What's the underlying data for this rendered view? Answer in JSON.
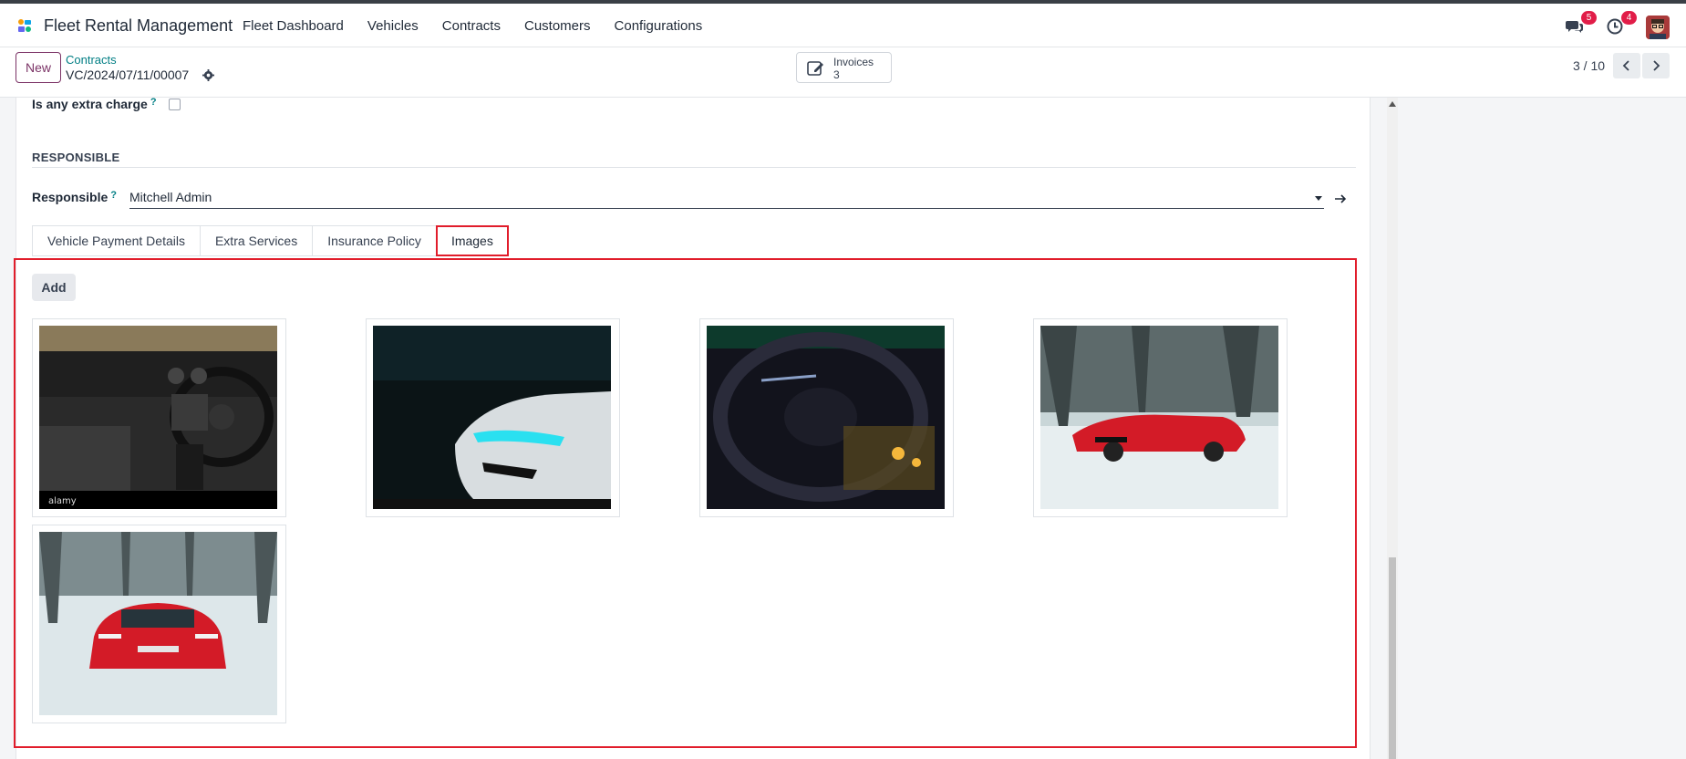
{
  "nav": {
    "app_name": "Fleet Rental Management",
    "menu": [
      "Fleet Dashboard",
      "Vehicles",
      "Contracts",
      "Customers",
      "Configurations"
    ],
    "messages_count": "5",
    "activities_count": "4"
  },
  "control_panel": {
    "new_label": "New",
    "breadcrumb_parent": "Contracts",
    "breadcrumb_current": "VC/2024/07/11/00007",
    "invoices_label": "Invoices",
    "invoices_count": "3",
    "pager": "3 / 10"
  },
  "form": {
    "extra_charge_label": "Is any extra charge",
    "extra_charge_checked": false,
    "responsible_section": "RESPONSIBLE",
    "responsible_label": "Responsible",
    "responsible_value": "Mitchell Admin",
    "help_mark": "?"
  },
  "tabs": [
    {
      "label": "Vehicle Payment Details",
      "active": false
    },
    {
      "label": "Extra Services",
      "active": false
    },
    {
      "label": "Insurance Policy",
      "active": false
    },
    {
      "label": "Images",
      "active": true
    }
  ],
  "images": {
    "add_label": "Add",
    "items": [
      {
        "subject": "car-interior-dashboard"
      },
      {
        "subject": "white-car-headlight"
      },
      {
        "subject": "steering-wheel-night"
      },
      {
        "subject": "red-car-snow-side"
      },
      {
        "subject": "red-car-snow-front"
      }
    ],
    "watermark": "alamy"
  },
  "colors": {
    "brand_primary": "#7b3366",
    "link_teal": "#017e84",
    "highlight_red": "#e11d2b",
    "badge_red": "#e11d48"
  }
}
